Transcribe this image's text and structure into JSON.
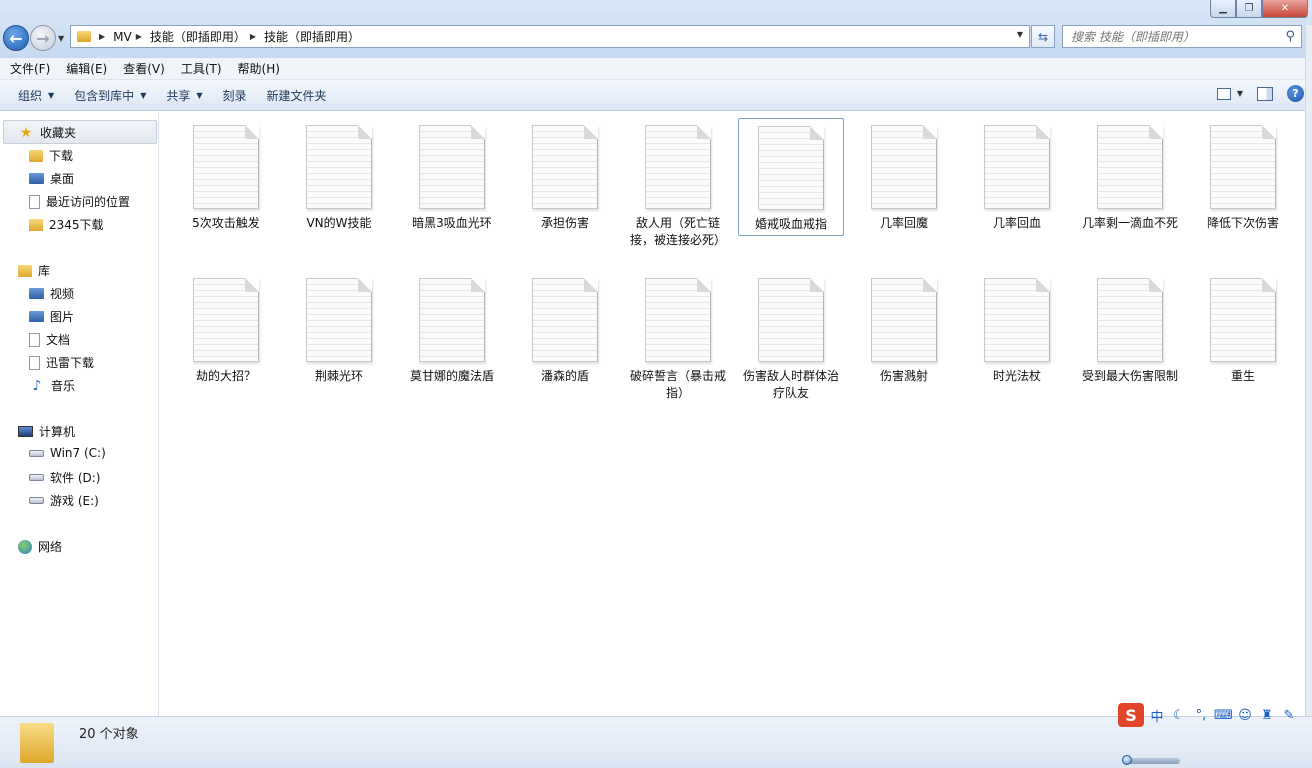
{
  "address": {
    "crumbs": [
      "MV",
      "技能（即插即用）",
      "技能（即插即用）"
    ]
  },
  "search": {
    "placeholder": "搜索 技能（即插即用）"
  },
  "menu": [
    "文件(F)",
    "编辑(E)",
    "查看(V)",
    "工具(T)",
    "帮助(H)"
  ],
  "toolbar": {
    "organize": "组织",
    "include_library": "包含到库中",
    "share": "共享",
    "burn": "刻录",
    "new_folder": "新建文件夹"
  },
  "nav": {
    "favorites": "收藏夹",
    "downloads": "下载",
    "desktop": "桌面",
    "recent": "最近访问的位置",
    "dl2345": "2345下载",
    "libraries": "库",
    "videos": "视频",
    "pictures": "图片",
    "documents": "文档",
    "thunder": "迅雷下载",
    "music": "音乐",
    "computer": "计算机",
    "drive_c": "Win7 (C:)",
    "drive_d": "软件 (D:)",
    "drive_e": "游戏 (E:)",
    "network": "网络"
  },
  "files": [
    "5次攻击触发",
    "VN的W技能",
    "暗黑3吸血光环",
    "承担伤害",
    "敌人用（死亡链接，被连接必死）",
    "婚戒吸血戒指",
    "几率回魔",
    "几率回血",
    "几率剩一滴血不死",
    "降低下次伤害",
    "劫的大招？",
    "荆棘光环",
    "莫甘娜的魔法盾",
    "潘森的盾",
    "破碎誓言（暴击戒指）",
    "伤害敌人时群体治疗队友",
    "伤害溅射",
    "时光法杖",
    "受到最大伤害限制",
    "重生"
  ],
  "selected_file_index": 5,
  "status": {
    "count": "20 个对象"
  },
  "ime": {
    "logo": "S",
    "lang": "中"
  }
}
